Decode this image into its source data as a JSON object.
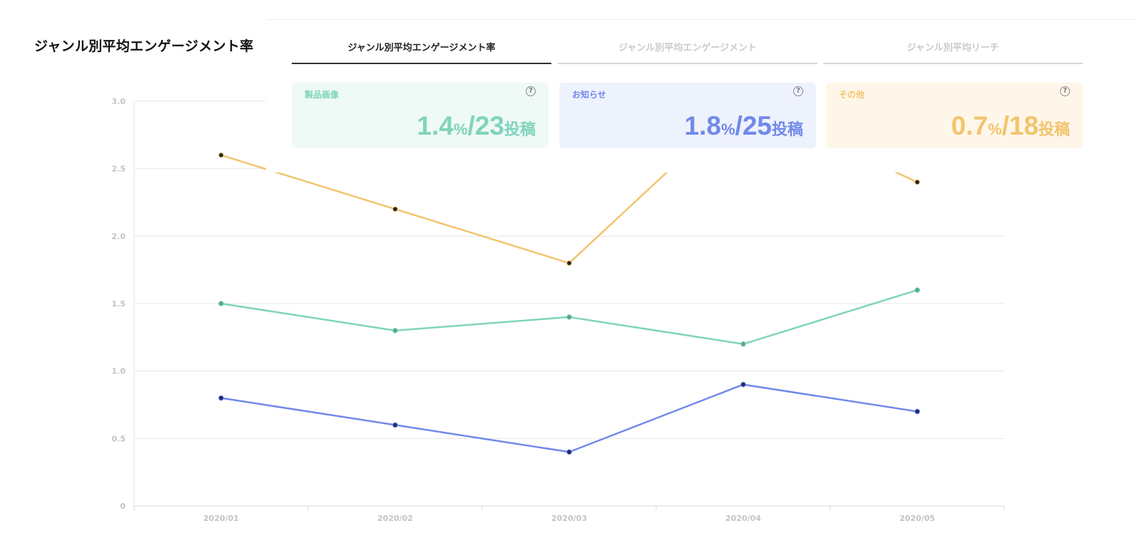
{
  "page_title": "ジャンル別平均エンゲージメント率",
  "tabs": [
    {
      "label": "ジャンル別平均エンゲージメント率",
      "active": true
    },
    {
      "label": "ジャンル別平均エンゲージメント",
      "active": false
    },
    {
      "label": "ジャンル別平均リーチ",
      "active": false
    }
  ],
  "cards": [
    {
      "label": "製品画像",
      "rate": "1.4",
      "rate_unit": "%",
      "posts": "/23",
      "posts_unit": "投稿",
      "color": "#7fd4bb",
      "bg": "#eff9f6",
      "help_icon": "question-circle-icon"
    },
    {
      "label": "お知らせ",
      "rate": "1.8",
      "rate_unit": "%",
      "posts": "/25",
      "posts_unit": "投稿",
      "color": "#7189ea",
      "bg": "#eef2fc",
      "help_icon": "question-circle-icon"
    },
    {
      "label": "その他",
      "rate": "0.7",
      "rate_unit": "%",
      "posts": "/18",
      "posts_unit": "投稿",
      "color": "#f2c46c",
      "bg": "#fff6ea",
      "help_icon": "question-circle-icon"
    }
  ],
  "chart_data": {
    "type": "line",
    "categories": [
      "2020/01",
      "2020/02",
      "2020/03",
      "2020/04",
      "2020/05"
    ],
    "series": [
      {
        "values": [
          2.6,
          2.2,
          1.8,
          3.0,
          2.4
        ],
        "color": "#f2c46c",
        "marker": "#222222"
      },
      {
        "values": [
          1.5,
          1.3,
          1.4,
          1.2,
          1.6
        ],
        "color": "#7fd4bb",
        "marker": "#5aa58f"
      },
      {
        "values": [
          0.8,
          0.6,
          0.4,
          0.9,
          0.7
        ],
        "color": "#7189ea",
        "marker": "#1c2a66"
      }
    ],
    "ylim": [
      0,
      3
    ],
    "yticks": [
      "0",
      "0.5",
      "1.0",
      "1.5",
      "2.0",
      "2.5",
      "3.0"
    ],
    "grid": true
  }
}
